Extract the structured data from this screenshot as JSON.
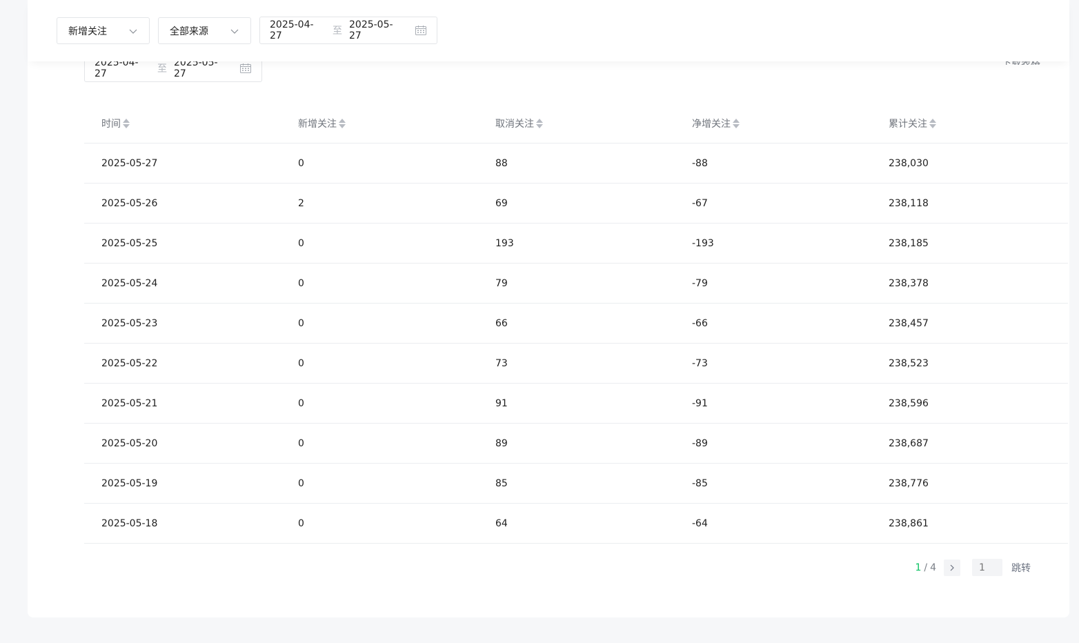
{
  "toolbar": {
    "type_select": "新增关注",
    "source_select": "全部来源",
    "date_start": "2025-04-27",
    "date_sep": "至",
    "date_end": "2025-05-27"
  },
  "underlying": {
    "date_start": "2025-04-27",
    "date_sep": "至",
    "date_end": "2025-05-27",
    "download": "下载表格"
  },
  "table": {
    "headers": [
      "时间",
      "新增关注",
      "取消关注",
      "净增关注",
      "累计关注"
    ],
    "rows": [
      [
        "2025-05-27",
        "0",
        "88",
        "-88",
        "238,030"
      ],
      [
        "2025-05-26",
        "2",
        "69",
        "-67",
        "238,118"
      ],
      [
        "2025-05-25",
        "0",
        "193",
        "-193",
        "238,185"
      ],
      [
        "2025-05-24",
        "0",
        "79",
        "-79",
        "238,378"
      ],
      [
        "2025-05-23",
        "0",
        "66",
        "-66",
        "238,457"
      ],
      [
        "2025-05-22",
        "0",
        "73",
        "-73",
        "238,523"
      ],
      [
        "2025-05-21",
        "0",
        "91",
        "-91",
        "238,596"
      ],
      [
        "2025-05-20",
        "0",
        "89",
        "-89",
        "238,687"
      ],
      [
        "2025-05-19",
        "0",
        "85",
        "-85",
        "238,776"
      ],
      [
        "2025-05-18",
        "0",
        "64",
        "-64",
        "238,861"
      ]
    ]
  },
  "pagination": {
    "current": "1",
    "separator": "/",
    "total": "4",
    "jump_placeholder": "1",
    "jump_label": "跳转"
  },
  "colors": {
    "accent": "#07c160",
    "border": "#e3e5e8",
    "page_bg": "#f6f7f9"
  }
}
